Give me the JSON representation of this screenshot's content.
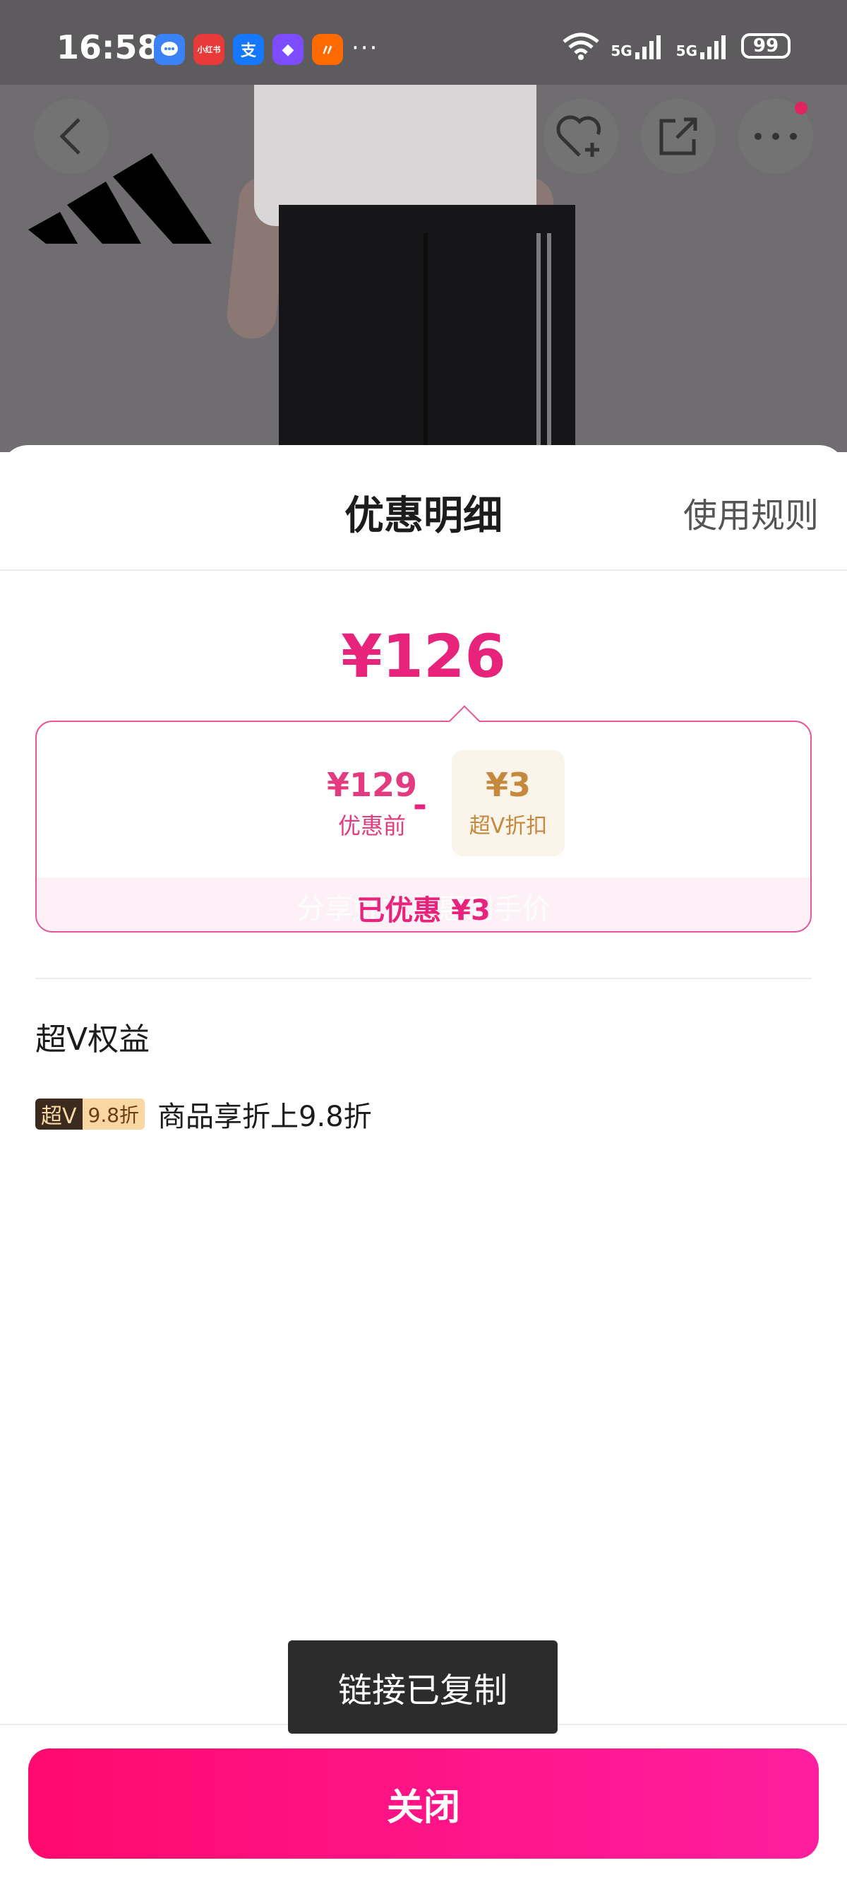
{
  "status_bar": {
    "time": "16:58",
    "app_icons": [
      {
        "name": "message-icon",
        "glyph": "💬",
        "color": "#3b82f6"
      },
      {
        "name": "xiaohongshu-icon",
        "glyph": "小红书",
        "color": "#e93a3a"
      },
      {
        "name": "alipay-icon",
        "glyph": "支",
        "color": "#1677ff"
      },
      {
        "name": "app-purple-icon",
        "glyph": "◆",
        "color": "#7c4dff"
      },
      {
        "name": "app-orange-icon",
        "glyph": "〃",
        "color": "#ff6a00"
      }
    ],
    "more": "···",
    "signal_1": "5G",
    "signal_2": "5G",
    "battery": "99"
  },
  "sheet": {
    "title": "优惠明细",
    "rules_link": "使用规则",
    "final_price": "¥126",
    "calc": {
      "before_value": "¥129",
      "before_label": "优惠前",
      "minus": "-",
      "discount_value": "¥3",
      "discount_label": "超V折扣",
      "ghost_text": "分享好友优惠到手价",
      "saved_text": "已优惠 ¥3"
    },
    "benefits": {
      "title": "超V权益",
      "badge_a": "超V",
      "badge_b": "9.8折",
      "text": "商品享折上9.8折"
    }
  },
  "toast": "链接已复制",
  "close_button": "关闭",
  "colors": {
    "accent": "#e8237b",
    "button_gradient_start": "#ff0a6e",
    "button_gradient_end": "#ff1e9f"
  }
}
